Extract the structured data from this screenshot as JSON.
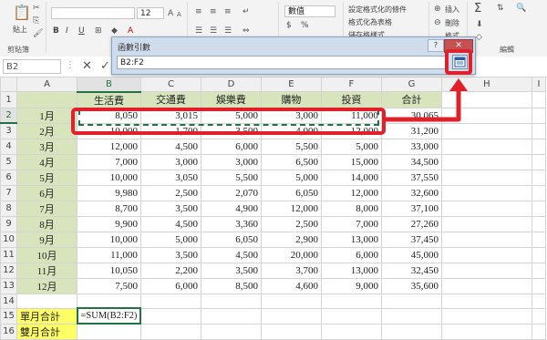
{
  "ribbon": {
    "paste_label": "貼上",
    "clipboard_label": "剪貼簿",
    "font_size": "12",
    "bold": "B",
    "italic": "I",
    "underline": "U",
    "number_format": "數值",
    "currency_symbol": "$",
    "percent_symbol": "%",
    "cond_format": "設定格式化的條件",
    "format_table": "格式化為表格",
    "cell_styles": "儲存格樣式",
    "insert": "插入",
    "delete": "刪除",
    "format": "格式",
    "edit_label": "編輯",
    "sigma": "Σ"
  },
  "formula_bar": {
    "name_box": "B2",
    "cancel": "✕",
    "confirm": "✓"
  },
  "dialog": {
    "title": "函數引數",
    "input_value": "B2:F2",
    "help": "?",
    "close": "✕"
  },
  "grid": {
    "columns": [
      "A",
      "B",
      "C",
      "D",
      "E",
      "F",
      "G",
      "H",
      "I"
    ],
    "header_row": [
      "",
      "生活費",
      "交通費",
      "娛樂費",
      "購物",
      "投資",
      "合計"
    ],
    "rows": [
      {
        "n": "2",
        "month": "1月",
        "vals": [
          "8,050",
          "3,015",
          "5,000",
          "3,000",
          "11,000"
        ],
        "total": "30,065"
      },
      {
        "n": "3",
        "month": "2月",
        "vals": [
          "10,000",
          "1,700",
          "3,500",
          "4,000",
          "12,000"
        ],
        "total": "31,200"
      },
      {
        "n": "4",
        "month": "3月",
        "vals": [
          "12,000",
          "4,500",
          "6,000",
          "5,500",
          "5,000"
        ],
        "total": "33,000"
      },
      {
        "n": "5",
        "month": "4月",
        "vals": [
          "7,000",
          "3,000",
          "3,000",
          "6,500",
          "15,000"
        ],
        "total": "34,500"
      },
      {
        "n": "6",
        "month": "5月",
        "vals": [
          "10,000",
          "3,050",
          "5,500",
          "5,000",
          "14,000"
        ],
        "total": "37,550"
      },
      {
        "n": "7",
        "month": "6月",
        "vals": [
          "9,980",
          "2,500",
          "2,070",
          "6,050",
          "12,000"
        ],
        "total": "32,600"
      },
      {
        "n": "8",
        "month": "7月",
        "vals": [
          "8,700",
          "3,500",
          "4,900",
          "12,000",
          "8,000"
        ],
        "total": "37,100"
      },
      {
        "n": "9",
        "month": "8月",
        "vals": [
          "9,900",
          "4,500",
          "3,360",
          "2,500",
          "7,000"
        ],
        "total": "27,260"
      },
      {
        "n": "10",
        "month": "9月",
        "vals": [
          "10,000",
          "5,000",
          "6,050",
          "2,900",
          "13,000"
        ],
        "total": "37,450"
      },
      {
        "n": "11",
        "month": "10月",
        "vals": [
          "11,000",
          "3,500",
          "4,500",
          "20,000",
          "6,000"
        ],
        "total": "45,000"
      },
      {
        "n": "12",
        "month": "11月",
        "vals": [
          "10,050",
          "2,200",
          "3,500",
          "3,700",
          "13,000"
        ],
        "total": "32,450"
      },
      {
        "n": "13",
        "month": "12月",
        "vals": [
          "7,500",
          "6,000",
          "8,500",
          "4,600",
          "9,000"
        ],
        "total": "35,600"
      }
    ],
    "row15_label": "單月合計",
    "row15_formula": "=SUM(B2:F2)",
    "row16_label": "雙月合計"
  },
  "colors": {
    "accent": "#217346",
    "annotation": "#e0202a",
    "header_fill": "#d8e4bc",
    "summary_fill": "#ffff66"
  }
}
